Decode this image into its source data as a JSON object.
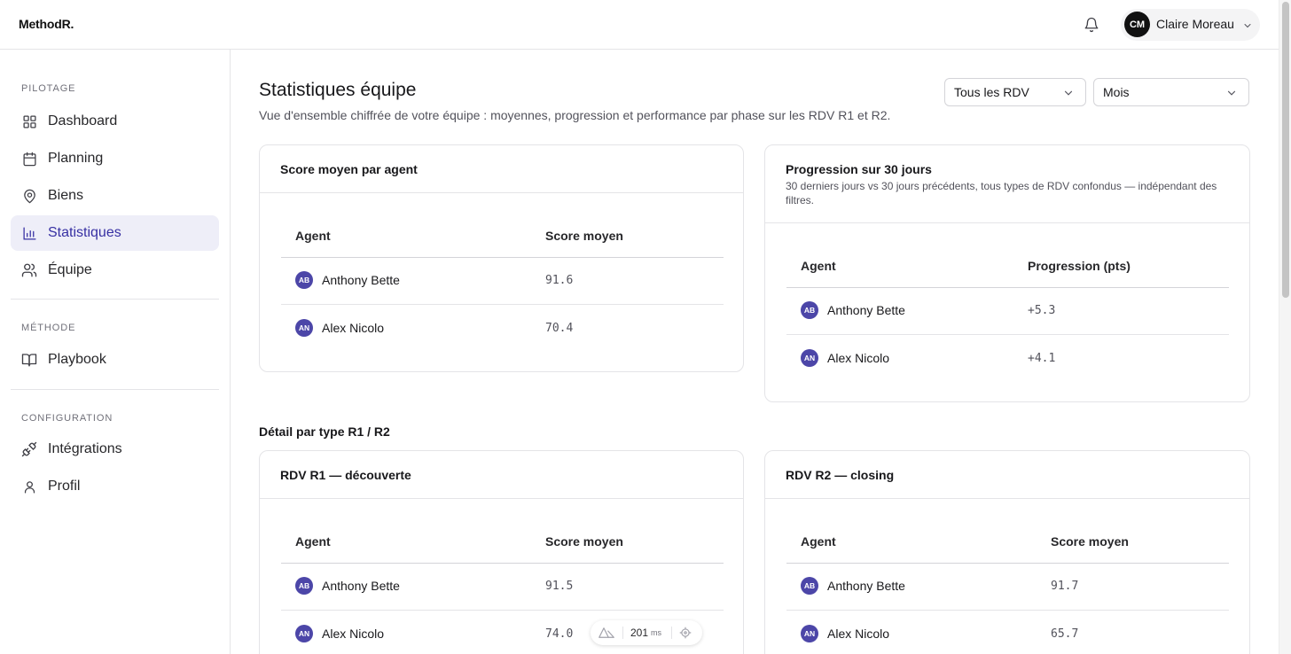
{
  "app": {
    "logo": "MethodR."
  },
  "user": {
    "initials": "CM",
    "name": "Claire Moreau"
  },
  "sidebar": {
    "sections": [
      {
        "label": "PILOTAGE",
        "items": [
          {
            "label": "Dashboard",
            "icon": "grid-icon"
          },
          {
            "label": "Planning",
            "icon": "calendar-icon"
          },
          {
            "label": "Biens",
            "icon": "map-pin-icon"
          },
          {
            "label": "Statistiques",
            "icon": "bar-chart-icon",
            "active": true
          },
          {
            "label": "Équipe",
            "icon": "users-icon"
          }
        ]
      },
      {
        "label": "MÉTHODE",
        "items": [
          {
            "label": "Playbook",
            "icon": "book-icon"
          }
        ]
      },
      {
        "label": "CONFIGURATION",
        "items": [
          {
            "label": "Intégrations",
            "icon": "plug-icon"
          },
          {
            "label": "Profil",
            "icon": "user-icon"
          }
        ]
      }
    ]
  },
  "header": {
    "title": "Statistiques équipe",
    "subtitle": "Vue d'ensemble chiffrée de votre équipe : moyennes, progression et performance par phase sur les RDV R1 et R2.",
    "filter_rdv": "Tous les RDV",
    "filter_period": "Mois"
  },
  "cards": {
    "score_moyen": {
      "title": "Score moyen par agent",
      "col_agent": "Agent",
      "col_value": "Score moyen",
      "rows": [
        {
          "initials": "AB",
          "name": "Anthony Bette",
          "value": "91.6"
        },
        {
          "initials": "AN",
          "name": "Alex Nicolo",
          "value": "70.4"
        }
      ]
    },
    "progression": {
      "title": "Progression sur 30 jours",
      "description": "30 derniers jours vs 30 jours précédents, tous types de RDV confondus — indépendant des filtres.",
      "col_agent": "Agent",
      "col_value": "Progression (pts)",
      "rows": [
        {
          "initials": "AB",
          "name": "Anthony Bette",
          "value": "+5.3"
        },
        {
          "initials": "AN",
          "name": "Alex Nicolo",
          "value": "+4.1"
        }
      ]
    },
    "r1": {
      "title": "RDV R1 — découverte",
      "col_agent": "Agent",
      "col_value": "Score moyen",
      "rows": [
        {
          "initials": "AB",
          "name": "Anthony Bette",
          "value": "91.5"
        },
        {
          "initials": "AN",
          "name": "Alex Nicolo",
          "value": "74.0"
        }
      ]
    },
    "r2": {
      "title": "RDV R2 — closing",
      "col_agent": "Agent",
      "col_value": "Score moyen",
      "rows": [
        {
          "initials": "AB",
          "name": "Anthony Bette",
          "value": "91.7"
        },
        {
          "initials": "AN",
          "name": "Alex Nicolo",
          "value": "65.7"
        }
      ]
    }
  },
  "detail_section_title": "Détail par type R1 / R2",
  "perf_widget": {
    "value": "201",
    "unit": "ms"
  },
  "colors": {
    "accent": "#3730a3",
    "avatar": "#4c46a8",
    "active_bg": "#eeeef8"
  }
}
